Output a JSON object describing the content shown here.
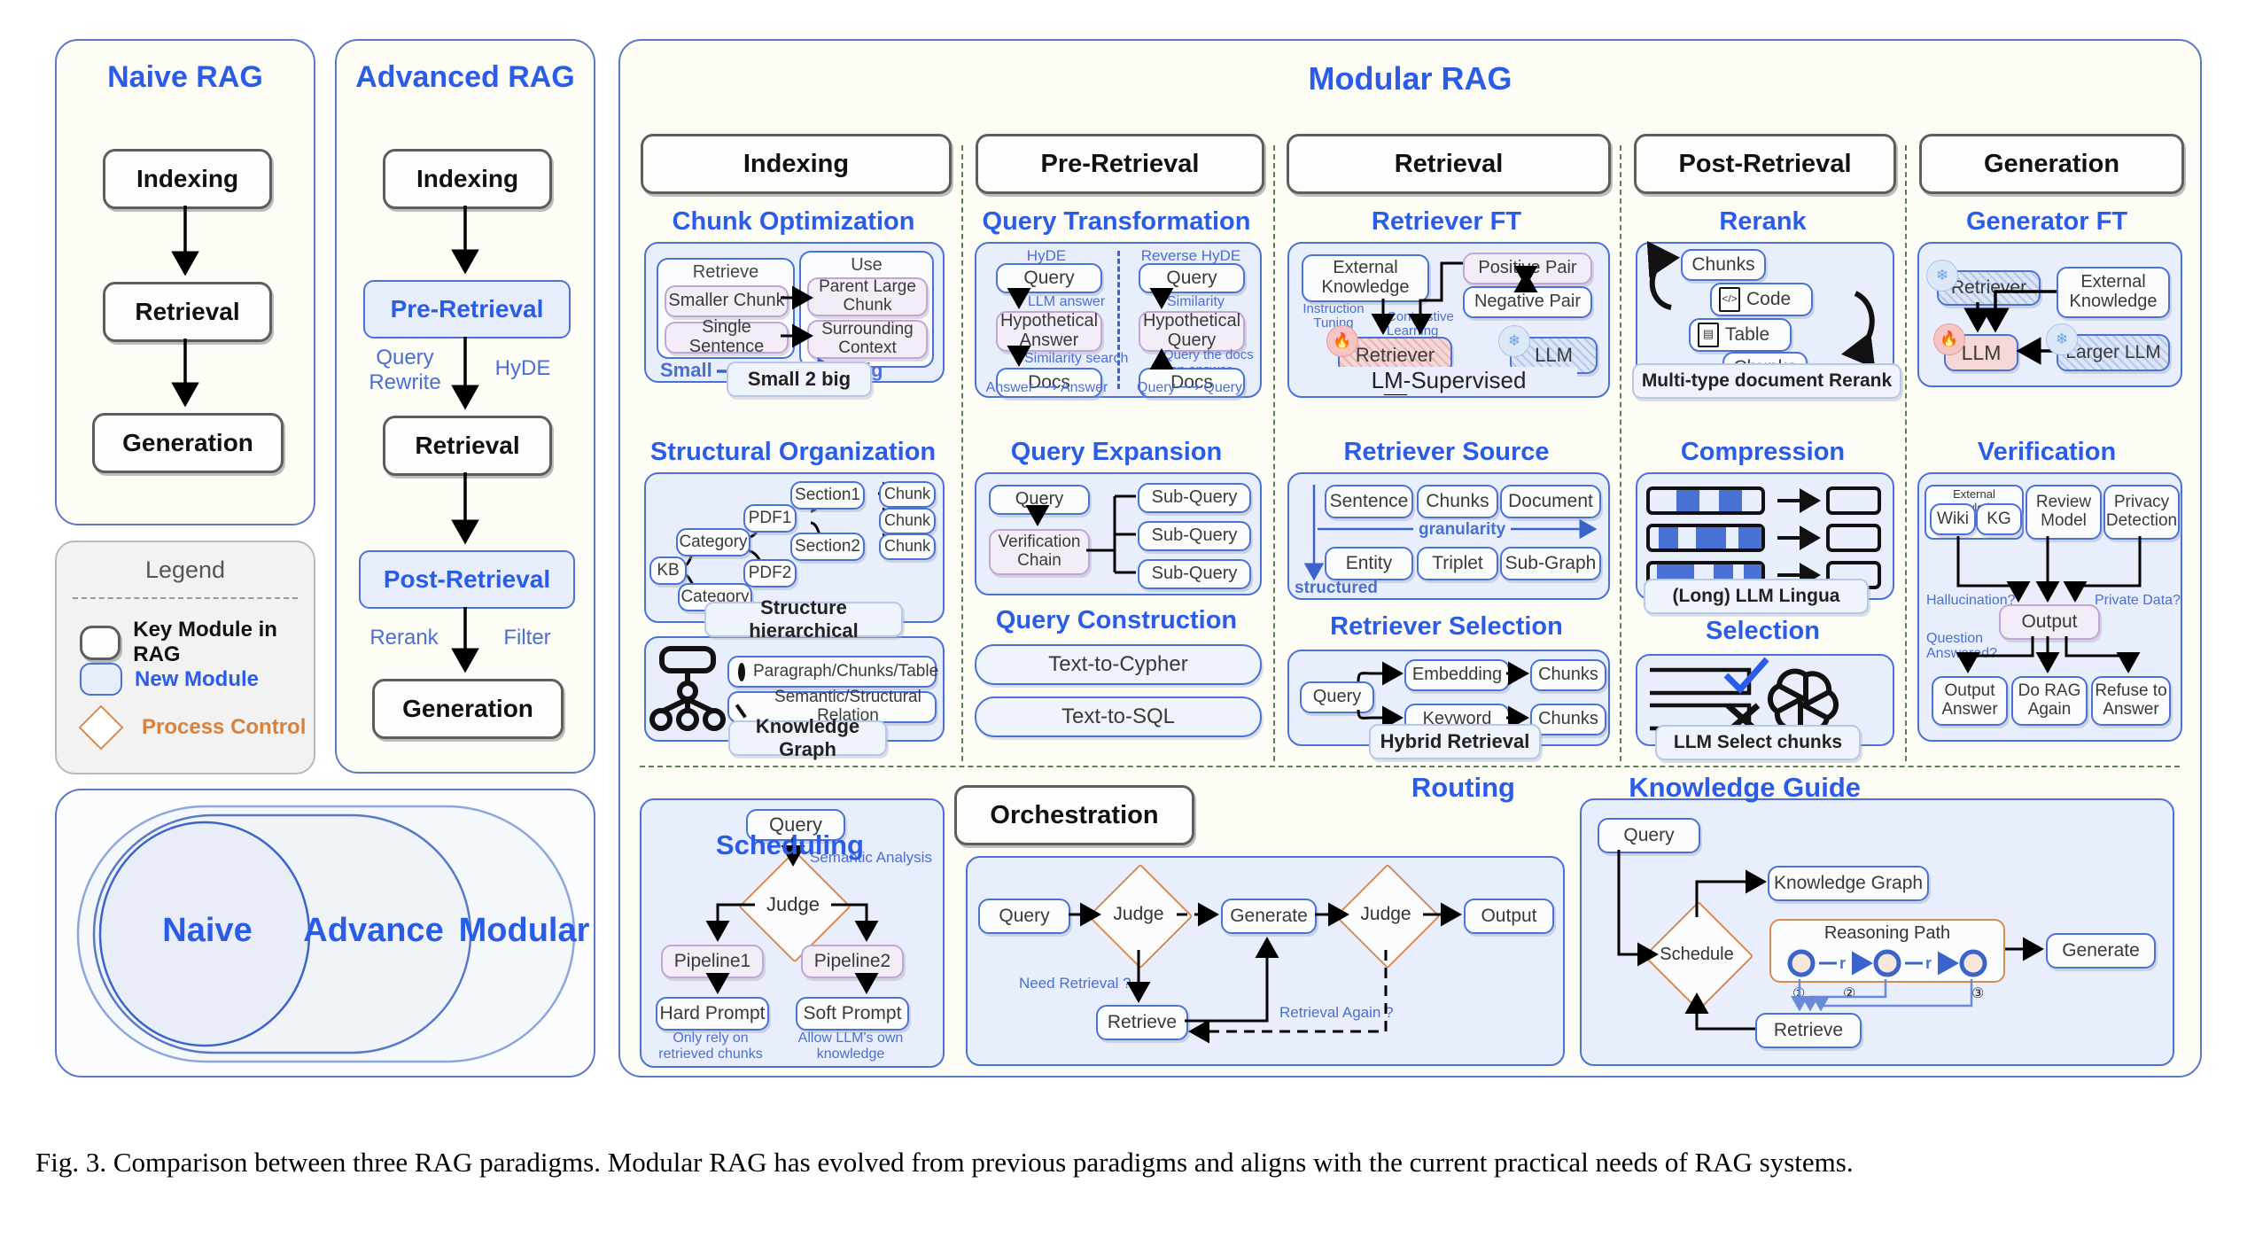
{
  "figure": {
    "caption": "Fig. 3.   Comparison between three RAG paradigms. Modular RAG has evolved from previous paradigms and aligns with the current practical needs of RAG systems."
  },
  "naive": {
    "title": "Naive RAG",
    "steps": [
      "Indexing",
      "Retrieval",
      "Generation"
    ]
  },
  "advanced": {
    "title": "Advanced RAG",
    "indexing": "Indexing",
    "pre_retrieval": "Pre-Retrieval",
    "pre_labels": [
      "Query Rewrite",
      "HyDE"
    ],
    "retrieval": "Retrieval",
    "post_retrieval": "Post-Retrieval",
    "post_labels": [
      "Rerank",
      "Filter"
    ],
    "generation": "Generation"
  },
  "legend": {
    "title": "Legend",
    "items": [
      {
        "label": "Key Module in RAG",
        "kind": "key-module"
      },
      {
        "label": "New Module",
        "kind": "new-module"
      },
      {
        "label": "Process Control",
        "kind": "process-control"
      }
    ],
    "colors": {
      "key_module": "#5d5d5d",
      "new_module": "#4a72d6",
      "process_control": "#d98a4e"
    }
  },
  "venn": {
    "labels": [
      "Naive",
      "Advance",
      "Modular"
    ]
  },
  "modular": {
    "title": "Modular RAG",
    "stages": [
      "Indexing",
      "Pre-Retrieval",
      "Retrieval",
      "Post-Retrieval",
      "Generation"
    ],
    "indexing": {
      "chunk_optimization": {
        "title": "Chunk Optimization",
        "retrieve_label": "Retrieve",
        "use_label": "Use",
        "retrieve_items": [
          "Smaller Chunk",
          "Single Sentence"
        ],
        "use_items": [
          "Parent Large Chunk",
          "Surrounding Context"
        ],
        "small": "Small",
        "big": "Big",
        "caption": "Small 2 big"
      },
      "structural_organization": {
        "title": "Structural Organization",
        "kb": "KB",
        "categories": [
          "Category",
          "Category"
        ],
        "pdfs": [
          "PDF1",
          "PDF2"
        ],
        "sections": [
          "Section1",
          "Section2"
        ],
        "chunks": [
          "Chunk",
          "Chunk",
          "Chunk"
        ],
        "caption": "Structure hierarchical",
        "kg": {
          "node_legend": "Paragraph/Chunks/Table",
          "edge_legend": "Semantic/Structural Relation",
          "caption": "Knowledge Graph"
        }
      }
    },
    "pre_retrieval": {
      "query_transformation": {
        "title": "Query Transformation",
        "left": {
          "head": "HyDE",
          "nodes": [
            "Query",
            "Hypothetical Answer",
            "Docs"
          ],
          "edges": [
            "LLM answer",
            "Similarity search"
          ],
          "foot": "Answer ⟶ Answer"
        },
        "right": {
          "head": "Reverse HyDE",
          "nodes": [
            "Query",
            "Hypothetical Query",
            "Docs"
          ],
          "edges": [
            "Similarity search",
            "Query the docs can answer"
          ],
          "foot": "Query ⟶ Query"
        }
      },
      "query_expansion": {
        "title": "Query Expansion",
        "query": "Query",
        "verification_chain": "Verification Chain",
        "sub_queries": [
          "Sub-Query",
          "Sub-Query",
          "Sub-Query"
        ]
      },
      "query_construction": {
        "title": "Query Construction",
        "items": [
          "Text-to-Cypher",
          "Text-to-SQL"
        ]
      }
    },
    "retrieval": {
      "retriever_ft": {
        "title": "Retriever FT",
        "external_knowledge": "External Knowledge",
        "positive_pair": "Positive Pair",
        "negative_pair": "Negative Pair",
        "retriever": "Retriever",
        "llm": "LLM",
        "edges": [
          "Instruction Tuning",
          "Contrastive Learning"
        ],
        "caption": "LM-Supervised"
      },
      "retriever_source": {
        "title": "Retriever Source",
        "row1": [
          "Sentence",
          "Chunks",
          "Document"
        ],
        "row2": [
          "Entity",
          "Triplet",
          "Sub-Graph"
        ],
        "axis_h": "granularity",
        "axis_v": "structured"
      },
      "retriever_selection": {
        "title": "Retriever Selection",
        "query": "Query",
        "branches": [
          "Embedding",
          "Keyword"
        ],
        "results": [
          "Chunks",
          "Chunks"
        ],
        "caption": "Hybrid Retrieval"
      }
    },
    "post_retrieval": {
      "rerank": {
        "title": "Rerank",
        "top": "Chunks",
        "code": "Code",
        "table": "Table",
        "bottom": "Chunks",
        "caption": "Multi-type document Rerank"
      },
      "compression": {
        "title": "Compression",
        "caption": "(Long) LLM Lingua",
        "rows": 3
      },
      "selection": {
        "title": "Selection",
        "caption": "LLM Select chunks"
      }
    },
    "generation": {
      "generator_ft": {
        "title": "Generator FT",
        "retriever": "Retriever",
        "external_knowledge": "External Knowledge",
        "llm": "LLM",
        "larger_llm": "Larger LLM"
      },
      "verification": {
        "title": "Verification",
        "external_knowledge": "External Knowledge",
        "wiki": "Wiki",
        "kg": "KG",
        "review_model": "Review Model",
        "privacy_detection": "Privacy Detection",
        "output": "Output",
        "labels": [
          "Hallucination?",
          "Private Data?",
          "Question Answered?"
        ],
        "outcomes": [
          "Output Answer",
          "Do RAG Again",
          "Refuse to Answer"
        ]
      }
    },
    "routing": {
      "title": "Routing",
      "query": "Query",
      "judge": "Judge",
      "semantic_analysis": "Semantic Analysis",
      "pipelines": [
        "Pipeline1",
        "Pipeline2"
      ],
      "prompts": [
        "Hard Prompt",
        "Soft Prompt"
      ],
      "notes": [
        "Only rely on retrieved chunks",
        "Allow LLM's own knowledge"
      ]
    },
    "orchestration": {
      "title": "Orchestration",
      "scheduling": {
        "title": "Scheduling",
        "nodes": [
          "Query",
          "Judge",
          "Generate",
          "Judge",
          "Output",
          "Retrieve"
        ],
        "labels": [
          "Need Retrieval ?",
          "Retrieval Again ?"
        ]
      },
      "knowledge_guide": {
        "title": "Knowledge Guide",
        "query": "Query",
        "schedule": "Schedule",
        "knowledge_graph": "Knowledge Graph",
        "reasoning_path": "Reasoning Path",
        "relation": "r",
        "generate": "Generate",
        "retrieve": "Retrieve",
        "steps": [
          "①",
          "②",
          "③"
        ]
      }
    }
  }
}
